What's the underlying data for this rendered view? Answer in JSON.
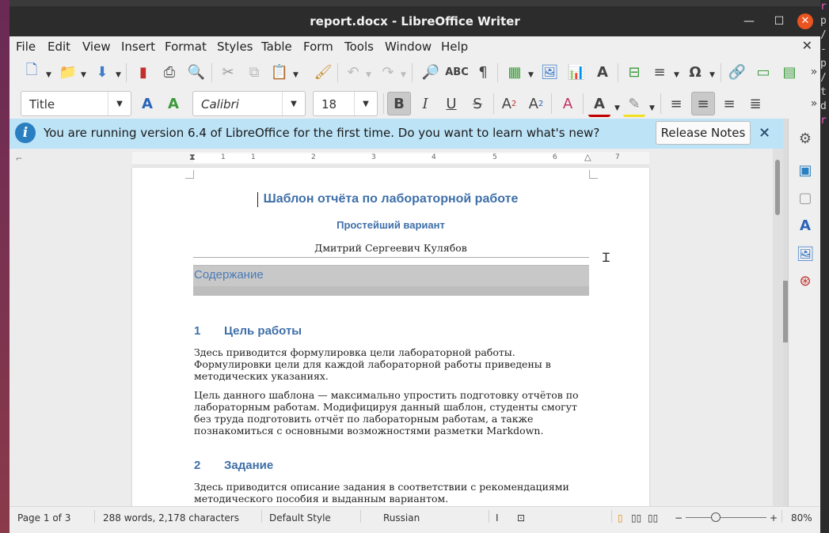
{
  "window": {
    "title": "report.docx - LibreOffice Writer"
  },
  "menubar": {
    "items": [
      "File",
      "Edit",
      "View",
      "Insert",
      "Format",
      "Styles",
      "Table",
      "Form",
      "Tools",
      "Window",
      "Help"
    ]
  },
  "toolbar": {
    "paragraph_style": "Title",
    "font_name": "Calibri",
    "font_size": "18",
    "bold_active": true,
    "center_align_active": true
  },
  "infobar": {
    "message": "You are running version 6.4 of LibreOffice for the first time. Do you want to learn what's new?",
    "button_label": "Release Notes"
  },
  "ruler": {
    "numbers": [
      "1",
      "1",
      "2",
      "3",
      "4",
      "5",
      "6",
      "7"
    ]
  },
  "document": {
    "title": "Шаблон отчёта по лабораторной работе",
    "subtitle": "Простейший вариант",
    "author": "Дмитрий Сергеевич Кулябов",
    "toc_title": "Содержание",
    "sections": [
      {
        "number": "1",
        "heading": "Цель работы",
        "paragraphs": [
          "Здесь приводится формулировка цели лабораторной работы. Формулировки цели для каждой лабораторной работы приведены в методических указаниях.",
          "Цель данного шаблона — максимально упростить подготовку отчётов по лабораторным работам. Модифицируя данный шаблон, студенты смогут без труда подготовить отчёт по лабораторным работам, а также познакомиться с основными возможностями разметки Markdown."
        ]
      },
      {
        "number": "2",
        "heading": "Задание",
        "paragraphs": [
          "Здесь приводится описание задания в соответствии с рекомендациями методического пособия и выданным вариантом."
        ]
      }
    ]
  },
  "statusbar": {
    "page": "Page 1 of 3",
    "words": "288 words, 2,178 characters",
    "page_style": "Default Style",
    "language": "Russian",
    "zoom": "80%"
  },
  "desktop": {
    "terminal_fragment": [
      "r",
      "p",
      "/",
      "-",
      "p",
      "/",
      "t",
      "d",
      "r"
    ]
  }
}
